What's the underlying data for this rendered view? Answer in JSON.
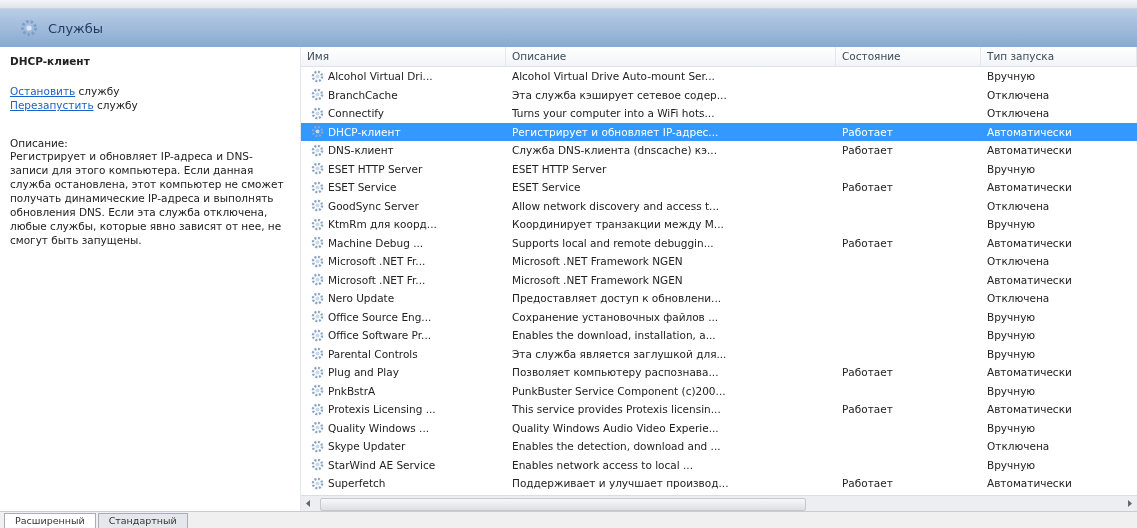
{
  "header": {
    "title": "Службы"
  },
  "details": {
    "service_name": "DHCP-клиент",
    "actions": [
      {
        "link": "Остановить",
        "text": "службу"
      },
      {
        "link": "Перезапустить",
        "text": "службу"
      }
    ],
    "description_label": "Описание:",
    "description": "Регистрирует и обновляет IP-адреса и DNS-записи для этого компьютера. Если данная служба остановлена, этот компьютер не сможет получать динамические IP-адреса и выполнять обновления DNS. Если эта служба отключена, любые службы, которые явно зависят от нее, не смогут быть запущены."
  },
  "table": {
    "columns": [
      "Имя",
      "Описание",
      "Состояние",
      "Тип запуска"
    ],
    "rows": [
      {
        "name": "Alcohol Virtual Dri...",
        "description": "Alcohol Virtual Drive Auto-mount Ser...",
        "startup": "Вручную",
        "selected": false
      },
      {
        "name": "BranchCache",
        "description": "Эта служба кэширует сетевое содер...",
        "startup": "Отключена",
        "selected": false
      },
      {
        "name": "Connectify",
        "description": "Turns your computer into a WiFi hots...",
        "startup": "Отключена",
        "selected": false
      },
      {
        "name": "DHCP-клиент",
        "description": "Регистрирует и обновляет IP-адрес...",
        "state": "Работает",
        "startup": "Автоматически",
        "selected": true
      },
      {
        "name": "DNS-клиент",
        "description": "Служба DNS-клиента (dnscache) кэ...",
        "state": "Работает",
        "startup": "Автоматически",
        "selected": false
      },
      {
        "name": "ESET HTTP Server",
        "description": "ESET HTTP Server",
        "startup": "Вручную",
        "selected": false
      },
      {
        "name": "ESET Service",
        "description": "ESET Service",
        "state": "Работает",
        "startup": "Автоматически",
        "selected": false
      },
      {
        "name": "GoodSync Server",
        "description": "Allow network discovery and access t...",
        "startup": "Отключена",
        "selected": false
      },
      {
        "name": "KtmRm для коорд...",
        "description": "Координирует транзакции между M...",
        "startup": "Вручную",
        "selected": false
      },
      {
        "name": "Machine Debug ...",
        "description": "Supports local and remote debuggin...",
        "state": "Работает",
        "startup": "Автоматически",
        "selected": false
      },
      {
        "name": "Microsoft .NET Fr...",
        "description": "Microsoft .NET Framework NGEN",
        "startup": "Отключена",
        "selected": false
      },
      {
        "name": "Microsoft .NET Fr...",
        "description": "Microsoft .NET Framework NGEN",
        "startup": "Автоматически",
        "selected": false
      },
      {
        "name": "Nero Update",
        "description": "Предоставляет доступ к обновлени...",
        "startup": "Отключена",
        "selected": false
      },
      {
        "name": "Office Source Eng...",
        "description": "Сохранение установочных файлов ...",
        "startup": "Вручную",
        "selected": false
      },
      {
        "name": "Office Software Pr...",
        "description": "Enables the download, installation, a...",
        "startup": "Вручную",
        "selected": false
      },
      {
        "name": "Parental Controls",
        "description": "Эта служба является заглушкой для...",
        "startup": "Вручную",
        "selected": false
      },
      {
        "name": "Plug and Play",
        "description": "Позволяет компьютеру распознава...",
        "state": "Работает",
        "startup": "Автоматически",
        "selected": false
      },
      {
        "name": "PnkBstrA",
        "description": "PunkBuster Service Component (c)200...",
        "startup": "Вручную",
        "selected": false
      },
      {
        "name": "Protexis Licensing ...",
        "description": "This service provides Protexis licensin...",
        "state": "Работает",
        "startup": "Автоматически",
        "selected": false
      },
      {
        "name": "Quality Windows ...",
        "description": "Quality Windows Audio Video Experie...",
        "startup": "Вручную",
        "selected": false
      },
      {
        "name": "Skype Updater",
        "description": "Enables the detection, download and ...",
        "startup": "Отключена",
        "selected": false
      },
      {
        "name": "StarWind AE Service",
        "description": "Enables network access to local ...",
        "startup": "Вручную",
        "selected": false
      },
      {
        "name": "Superfetch",
        "description": "Поддерживает и улучшает производ...",
        "state": "Работает",
        "startup": "Автоматически",
        "selected": false
      }
    ]
  },
  "tabs": [
    {
      "label": "Расширенный",
      "selected": true
    },
    {
      "label": "Стандартный",
      "selected": false
    }
  ]
}
